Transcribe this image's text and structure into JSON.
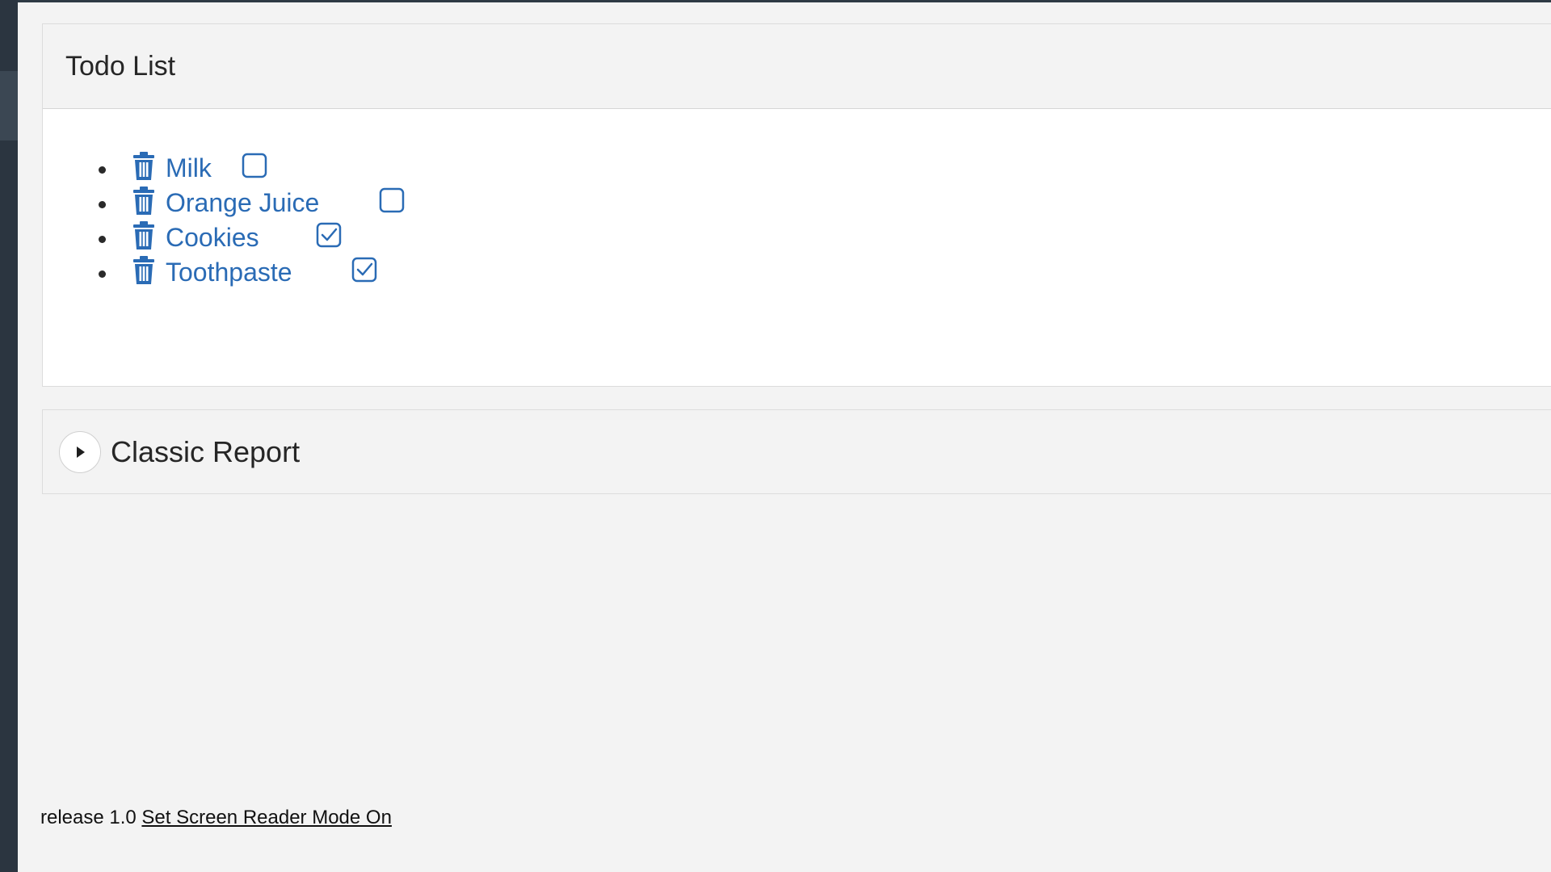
{
  "todo_region": {
    "title": "Todo List",
    "items": [
      {
        "label": "Milk",
        "checked": false
      },
      {
        "label": "Orange Juice",
        "checked": false
      },
      {
        "label": "Cookies",
        "checked": true
      },
      {
        "label": "Toothpaste",
        "checked": true
      }
    ]
  },
  "report_region": {
    "title": "Classic Report",
    "expand_icon": "play-triangle-icon"
  },
  "footer": {
    "release": "release 1.0",
    "screen_reader_link": "Set Screen Reader Mode On"
  },
  "icons": {
    "delete": "trash-icon",
    "unchecked": "checkbox-empty-icon",
    "checked": "checkbox-checked-icon"
  },
  "colors": {
    "accent": "#2a6bb5",
    "nav": "#2b3540",
    "background": "#f3f3f3"
  }
}
